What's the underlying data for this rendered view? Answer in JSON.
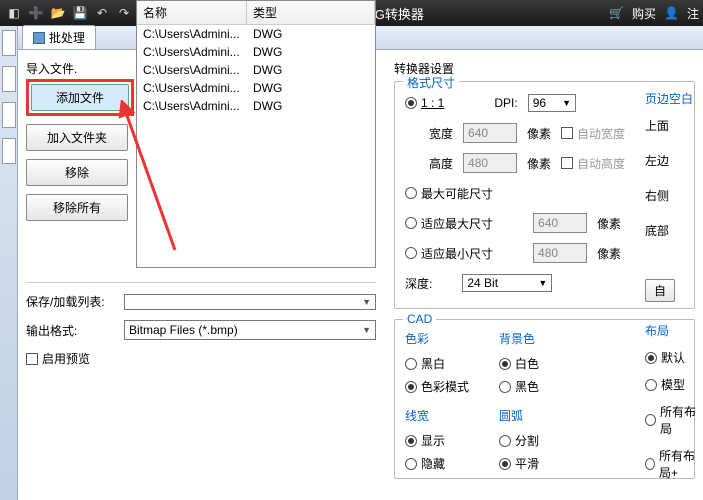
{
  "titlebar": {
    "title": "CAD转JPG转换器",
    "buy": "购买",
    "reg": "注"
  },
  "tab": {
    "label": "批处理"
  },
  "left": {
    "import_label": "导入文件.",
    "btn_add_file": "添加文件",
    "btn_add_folder": "加入文件夹",
    "btn_remove": "移除",
    "btn_remove_all": "移除所有",
    "th_name": "名称",
    "th_type": "类型",
    "rows": [
      {
        "name": "C:\\Users\\Admini...",
        "type": "DWG"
      },
      {
        "name": "C:\\Users\\Admini...",
        "type": "DWG"
      },
      {
        "name": "C:\\Users\\Admini...",
        "type": "DWG"
      },
      {
        "name": "C:\\Users\\Admini...",
        "type": "DWG"
      },
      {
        "name": "C:\\Users\\Admini...",
        "type": "DWG"
      }
    ],
    "save_list_label": "保存/加载列表:",
    "output_fmt_label": "输出格式:",
    "output_fmt_value": "Bitmap Files (*.bmp)",
    "preview_label": "启用预览"
  },
  "conv": {
    "title": "转换器设置",
    "fmt_size": "格式尺寸",
    "ratio_11": "1 : 1",
    "dpi_label": "DPI:",
    "dpi_value": "96",
    "width_label": "宽度",
    "width_value": "640",
    "px": "像素",
    "auto_width": "自动宽度",
    "height_label": "高度",
    "height_value": "480",
    "auto_height": "自动高度",
    "max_size": "最大可能尺寸",
    "fit_max": "适应最大尺寸",
    "fit_max_value": "640",
    "fit_min": "适应最小尺寸",
    "fit_min_value": "480",
    "depth_label": "深度:",
    "depth_value": "24 Bit"
  },
  "cad": {
    "title": "CAD",
    "color_title": "色彩",
    "bw": "黑白",
    "color_mode": "色彩模式",
    "bg_title": "背景色",
    "white": "白色",
    "black": "黑色",
    "lw_title": "线宽",
    "show": "显示",
    "hide": "隐藏",
    "arc_title": "圆弧",
    "split": "分割",
    "smooth": "平滑"
  },
  "margin": {
    "title": "页边空白",
    "top": "上面",
    "left": "左边",
    "right": "右侧",
    "bottom": "底部",
    "auto_btn": "自"
  },
  "layout": {
    "title": "布局",
    "default": "默认",
    "model": "模型",
    "all": "所有布局",
    "all_name": "所有布局+"
  }
}
